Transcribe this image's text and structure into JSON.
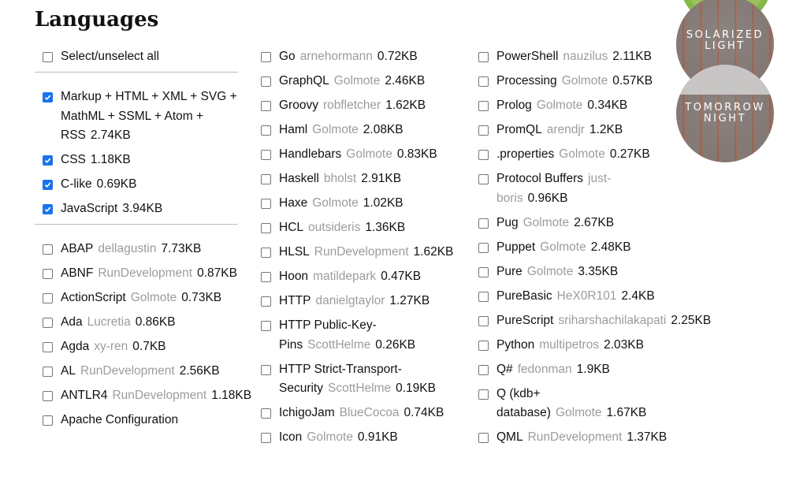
{
  "section_title": "Languages",
  "themes": [
    "SOLARIZED LIGHT",
    "TOMORROW NIGHT"
  ],
  "themes_lines": [
    [
      "SOLARIZED",
      "LIGHT"
    ],
    [
      "TOMORROW",
      "NIGHT"
    ]
  ],
  "select_all": {
    "label": "Select/unselect all",
    "checked": false
  },
  "core": [
    {
      "name": "Markup + HTML + XML + SVG + MathML + SSML + Atom + RSS",
      "author": "",
      "size": "2.74KB",
      "checked": true
    },
    {
      "name": "CSS",
      "author": "",
      "size": "1.18KB",
      "checked": true
    },
    {
      "name": "C-like",
      "author": "",
      "size": "0.69KB",
      "checked": true
    },
    {
      "name": "JavaScript",
      "author": "",
      "size": "3.94KB",
      "checked": true
    }
  ],
  "col1": [
    {
      "name": "ABAP",
      "author": "dellagustin",
      "size": "7.73KB"
    },
    {
      "name": "ABNF",
      "author": "RunDevelopment",
      "size": "0.87KB"
    },
    {
      "name": "ActionScript",
      "author": "Golmote",
      "size": "0.73KB"
    },
    {
      "name": "Ada",
      "author": "Lucretia",
      "size": "0.86KB"
    },
    {
      "name": "Agda",
      "author": "xy-ren",
      "size": "0.7KB"
    },
    {
      "name": "AL",
      "author": "RunDevelopment",
      "size": "2.56KB"
    },
    {
      "name": "ANTLR4",
      "author": "RunDevelopment",
      "size": "1.18KB"
    },
    {
      "name": "Apache Configuration",
      "author": "",
      "size": ""
    }
  ],
  "col2": [
    {
      "name": "Go",
      "author": "arnehormann",
      "size": "0.72KB"
    },
    {
      "name": "GraphQL",
      "author": "Golmote",
      "size": "2.46KB"
    },
    {
      "name": "Groovy",
      "author": "robfletcher",
      "size": "1.62KB"
    },
    {
      "name": "Haml",
      "author": "Golmote",
      "size": "2.08KB"
    },
    {
      "name": "Handlebars",
      "author": "Golmote",
      "size": "0.83KB"
    },
    {
      "name": "Haskell",
      "author": "bholst",
      "size": "2.91KB"
    },
    {
      "name": "Haxe",
      "author": "Golmote",
      "size": "1.02KB"
    },
    {
      "name": "HCL",
      "author": "outsideris",
      "size": "1.36KB"
    },
    {
      "name": "HLSL",
      "author": "RunDevelopment",
      "size": "1.62KB"
    },
    {
      "name": "Hoon",
      "author": "matildepark",
      "size": "0.47KB"
    },
    {
      "name": "HTTP",
      "author": "danielgtaylor",
      "size": "1.27KB"
    },
    {
      "name": "HTTP Public-Key-Pins",
      "author": "ScottHelme",
      "size": "0.26KB"
    },
    {
      "name": "HTTP Strict-Transport-Security",
      "author": "ScottHelme",
      "size": "0.19KB"
    },
    {
      "name": "IchigoJam",
      "author": "BlueCocoa",
      "size": "0.74KB"
    },
    {
      "name": "Icon",
      "author": "Golmote",
      "size": "0.91KB"
    }
  ],
  "col3": [
    {
      "name": "PowerShell",
      "author": "nauzilus",
      "size": "2.11KB"
    },
    {
      "name": "Processing",
      "author": "Golmote",
      "size": "0.57KB"
    },
    {
      "name": "Prolog",
      "author": "Golmote",
      "size": "0.34KB"
    },
    {
      "name": "PromQL",
      "author": "arendjr",
      "size": "1.2KB"
    },
    {
      "name": ".properties",
      "author": "Golmote",
      "size": "0.27KB"
    },
    {
      "name": "Protocol Buffers",
      "author": "just-boris",
      "size": "0.96KB"
    },
    {
      "name": "Pug",
      "author": "Golmote",
      "size": "2.67KB"
    },
    {
      "name": "Puppet",
      "author": "Golmote",
      "size": "2.48KB"
    },
    {
      "name": "Pure",
      "author": "Golmote",
      "size": "3.35KB"
    },
    {
      "name": "PureBasic",
      "author": "HeX0R101",
      "size": "2.4KB"
    },
    {
      "name": "PureScript",
      "author": "sriharshachilakapati",
      "size": "2.25KB"
    },
    {
      "name": "Python",
      "author": "multipetros",
      "size": "2.03KB"
    },
    {
      "name": "Q#",
      "author": "fedonman",
      "size": "1.9KB"
    },
    {
      "name": "Q (kdb+ database)",
      "author": "Golmote",
      "size": "1.67KB"
    },
    {
      "name": "QML",
      "author": "RunDevelopment",
      "size": "1.37KB"
    }
  ],
  "colors": {
    "accent": "#1a73e8",
    "author": "#9c9c9c",
    "text": "#111111"
  }
}
